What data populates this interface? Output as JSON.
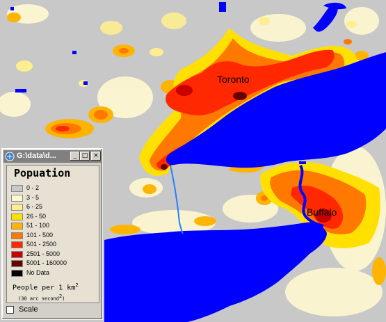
{
  "map": {
    "cities": [
      {
        "name": "Toronto"
      },
      {
        "name": "Buffalo"
      }
    ],
    "colors": {
      "background": "#c8c8c8",
      "water": "#0000ff"
    }
  },
  "legend_window": {
    "title": "G:\\data\\d...",
    "buttons": [
      "_",
      "□",
      "×"
    ],
    "title_icon": "window-app-icon",
    "panel": {
      "title": "Popuation",
      "classes": [
        {
          "label": "0 - 2",
          "color": "#c8c8c8"
        },
        {
          "label": "3 - 5",
          "color": "#fff9d0"
        },
        {
          "label": "6 - 25",
          "color": "#ffee90"
        },
        {
          "label": "26 - 50",
          "color": "#ffe000"
        },
        {
          "label": "51 - 100",
          "color": "#ffb400"
        },
        {
          "label": "101 - 500",
          "color": "#ff7800"
        },
        {
          "label": "501 - 2500",
          "color": "#ff2800"
        },
        {
          "label": "2501 - 5000",
          "color": "#c80000"
        },
        {
          "label": "5001 - 160000",
          "color": "#640000"
        },
        {
          "label": "No Data",
          "color": "#000000"
        }
      ],
      "units_prefix": "People per 1 km",
      "units_exp": "2",
      "units_sub_prefix": "(30 arc second",
      "units_sub_exp": "2",
      "units_sub_suffix": ")"
    },
    "scale_checkbox": {
      "label": "Scale",
      "checked": false
    }
  }
}
